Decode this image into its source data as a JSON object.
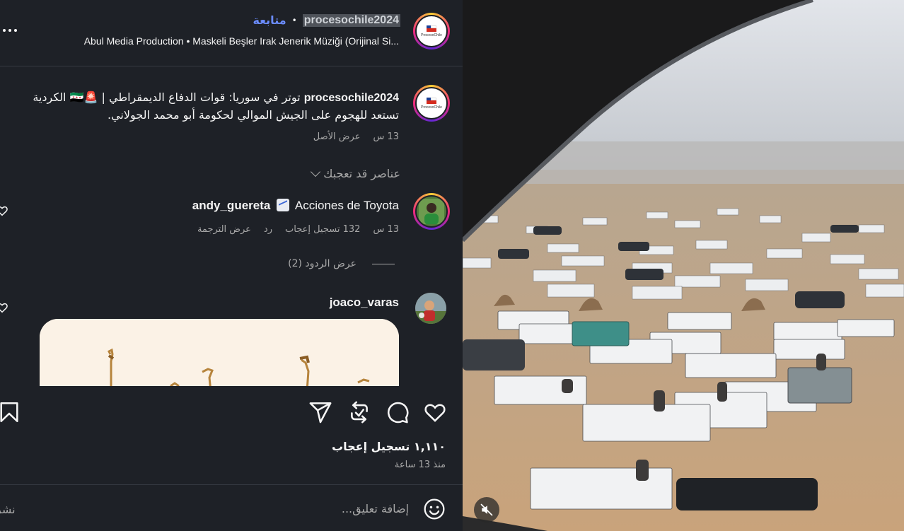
{
  "header": {
    "username": "procesochile2024",
    "follow_label": "متابعة",
    "separator": "•",
    "audio": "Abul Media Production • Maskeli Beşler Irak Jenerik Müziği (Orijinal Si...",
    "avatar_text": "ProcesoChile"
  },
  "caption": {
    "username": "procesochile2024",
    "text": "توتر في سوريا: قوات الدفاع الديمقراطي | 🚨🇸🇾 الكردية تستعد للهجوم على الجيش الموالي لحكومة أبو محمد الجولاني.",
    "time": "13 س",
    "see_original": "عرض الأصل"
  },
  "suggested_label": "عناصر قد تعجبك",
  "comments": [
    {
      "username": "andy_guereta",
      "text": "Acciones de Toyota",
      "time": "13 س",
      "likes": "132 تسجيل إعجاب",
      "reply": "رد",
      "translate": "عرض الترجمة",
      "view_replies": "عرض الردود (2)"
    },
    {
      "username": "joaco_varas"
    }
  ],
  "actions": {
    "likes": "١,١١٠ تسجيل إعجاب",
    "time_ago": "منذ 13 ساعة"
  },
  "comment_input": {
    "placeholder": "إضافة تعليق...",
    "post_label": "نشر"
  },
  "icons": [
    "more-icon",
    "heart-icon",
    "comment-icon",
    "repost-icon",
    "share-icon",
    "bookmark-icon",
    "emoji-icon",
    "mute-icon"
  ]
}
